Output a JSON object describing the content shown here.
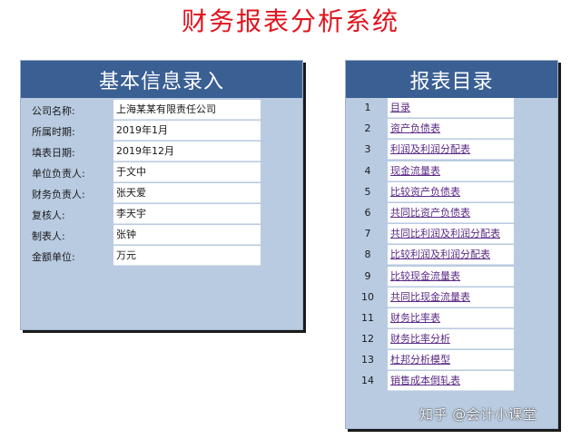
{
  "title": "财务报表分析系统",
  "left_panel": {
    "header": "基本信息录入",
    "rows": [
      {
        "label": "公司名称:",
        "value": "上海某某有限责任公司"
      },
      {
        "label": "所属时期:",
        "value": "2019年1月"
      },
      {
        "label": "填表日期:",
        "value": "2019年12月"
      },
      {
        "label": "单位负责人:",
        "value": "于文中"
      },
      {
        "label": "财务负责人:",
        "value": "张天爱"
      },
      {
        "label": "复核人:",
        "value": "李天宇"
      },
      {
        "label": "制表人:",
        "value": "张钟"
      },
      {
        "label": "金额单位:",
        "value": "万元"
      }
    ]
  },
  "right_panel": {
    "header": "报表目录",
    "items": [
      {
        "num": "1",
        "label": "目录"
      },
      {
        "num": "2",
        "label": "资产负债表"
      },
      {
        "num": "3",
        "label": "利润及利润分配表"
      },
      {
        "num": "4",
        "label": "现金流量表"
      },
      {
        "num": "5",
        "label": "比较资产负债表"
      },
      {
        "num": "6",
        "label": "共同比资产负债表"
      },
      {
        "num": "7",
        "label": "共同比利润及利润分配表"
      },
      {
        "num": "8",
        "label": "比较利润及利润分配表"
      },
      {
        "num": "9",
        "label": "比较现金流量表"
      },
      {
        "num": "10",
        "label": "共同比现金流量表"
      },
      {
        "num": "11",
        "label": "财务比率表"
      },
      {
        "num": "12",
        "label": "财务比率分析"
      },
      {
        "num": "13",
        "label": "杜邦分析模型"
      },
      {
        "num": "14",
        "label": "销售成本倒轧表"
      }
    ]
  },
  "watermark": "知乎 @会计小课堂",
  "colors": {
    "title": "#e0141e",
    "header_bg": "#3a5f93",
    "panel_bg": "#b9cbe1",
    "link": "#5b2a86"
  }
}
